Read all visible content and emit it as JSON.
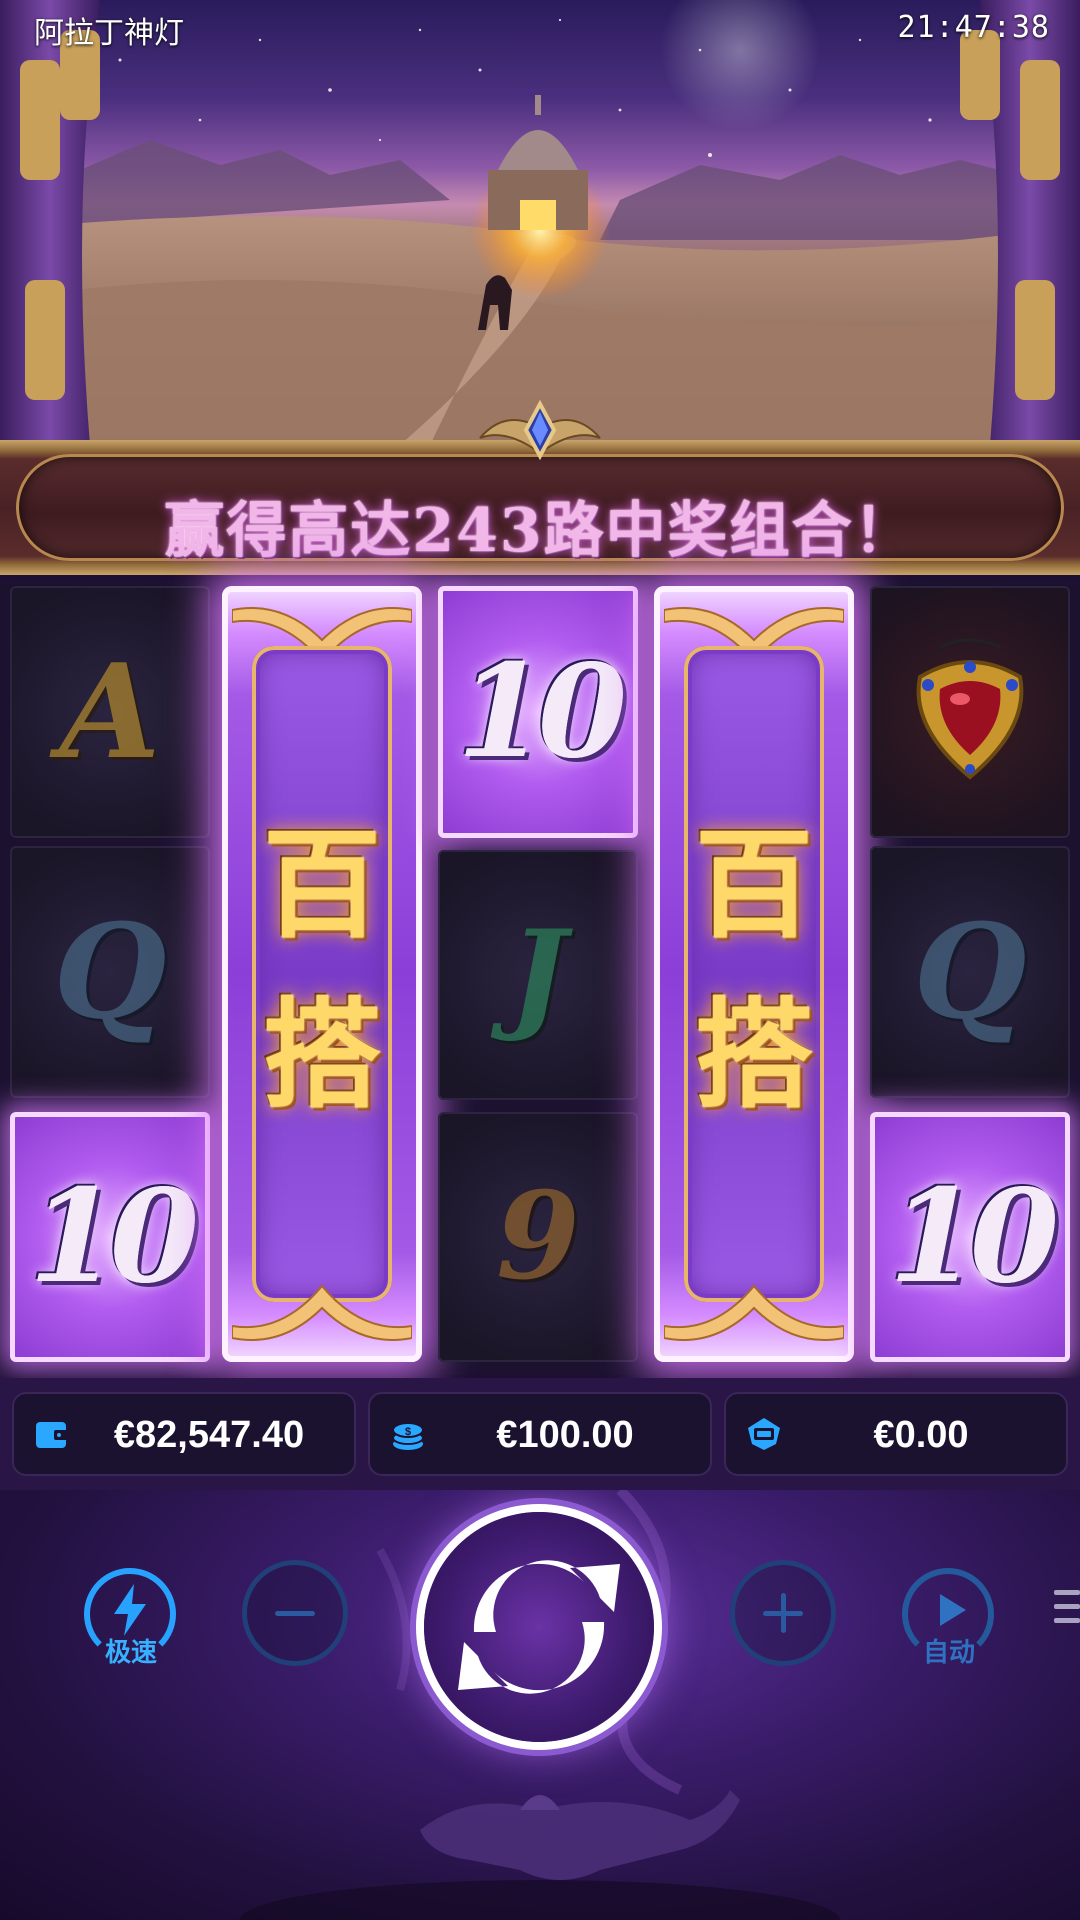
{
  "status_bar": {
    "app_title": "阿拉丁神灯",
    "time": "21:47:38"
  },
  "banner": {
    "text": "赢得高达243路中奖组合！"
  },
  "reels": {
    "reel1": [
      "A",
      "Q",
      "10"
    ],
    "reel2": {
      "wild": true,
      "label_line1": "百",
      "label_line2": "搭"
    },
    "reel3": [
      "10",
      "J",
      "9"
    ],
    "reel4": {
      "wild": true,
      "label_line1": "百",
      "label_line2": "搭"
    },
    "reel5": [
      "lamp-jewel",
      "Q",
      "10"
    ]
  },
  "info": {
    "balance": "€82,547.40",
    "bet": "€100.00",
    "win": "€0.00",
    "icons": [
      "wallet-icon",
      "coins-icon",
      "win-prize-icon"
    ]
  },
  "controls": {
    "turbo_label": "极速",
    "auto_label": "自动",
    "accent": "#27a3ff"
  }
}
